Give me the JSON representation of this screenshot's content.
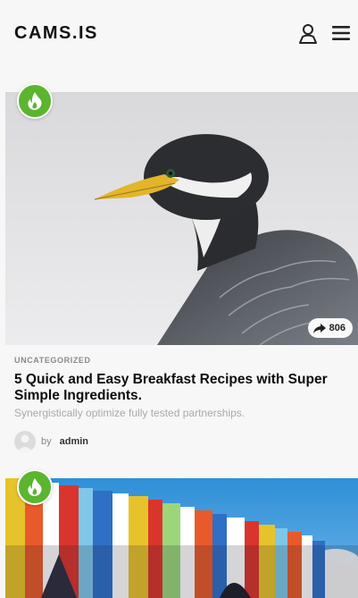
{
  "header": {
    "logo": "CAMS.IS",
    "icons": [
      "user-icon",
      "hamburger-menu-icon"
    ]
  },
  "posts": [
    {
      "category": "UNCATEGORIZED",
      "title": "5 Quick and Easy Breakfast Recipes with Super Simple Ingredients.",
      "excerpt": "Synergistically optimize fully tested partnerships.",
      "by_label": "by",
      "author": "admin",
      "share_count": "806",
      "badge_icon": "fire-icon"
    },
    {
      "badge_icon": "fire-icon"
    }
  ],
  "colors": {
    "accent_green": "#5bb52f",
    "background": "#f7f7f7"
  }
}
